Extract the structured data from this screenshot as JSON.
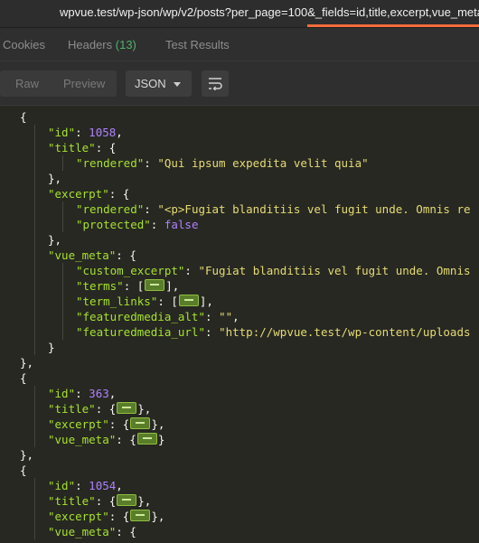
{
  "url_bar": {
    "url": "wpvue.test/wp-json/wp/v2/posts?per_page=100&_fields=id,title,excerpt,vue_meta"
  },
  "tabs": [
    {
      "label": "Cookies"
    },
    {
      "label": "Headers",
      "count": "(13)"
    },
    {
      "label": "Test Results"
    }
  ],
  "toolbar": {
    "raw_label": "Raw",
    "preview_label": "Preview",
    "format_selected": "JSON",
    "wrap_icon": "wrap-lines-icon"
  },
  "colors": {
    "background": "#272822",
    "key": "#a6e22e",
    "number": "#ae81ff",
    "string": "#e6db74",
    "punctuation": "#f8f8f2",
    "accent": "#f26b3a",
    "count": "#4fb26b"
  },
  "json_lines": [
    {
      "indent": 1,
      "parts": [
        {
          "t": "{",
          "c": "p"
        }
      ]
    },
    {
      "indent": 2,
      "parts": [
        {
          "t": "\"id\"",
          "c": "k"
        },
        {
          "t": ": ",
          "c": "p"
        },
        {
          "t": "1058",
          "c": "n"
        },
        {
          "t": ",",
          "c": "p"
        }
      ]
    },
    {
      "indent": 2,
      "parts": [
        {
          "t": "\"title\"",
          "c": "k"
        },
        {
          "t": ": {",
          "c": "p"
        }
      ]
    },
    {
      "indent": 3,
      "parts": [
        {
          "t": "\"rendered\"",
          "c": "k"
        },
        {
          "t": ": ",
          "c": "p"
        },
        {
          "t": "\"Qui ipsum expedita velit quia\"",
          "c": "s"
        }
      ]
    },
    {
      "indent": 2,
      "parts": [
        {
          "t": "},",
          "c": "p"
        }
      ]
    },
    {
      "indent": 2,
      "parts": [
        {
          "t": "\"excerpt\"",
          "c": "k"
        },
        {
          "t": ": {",
          "c": "p"
        }
      ]
    },
    {
      "indent": 3,
      "parts": [
        {
          "t": "\"rendered\"",
          "c": "k"
        },
        {
          "t": ": ",
          "c": "p"
        },
        {
          "t": "\"<p>Fugiat blanditiis vel fugit unde. Omnis re",
          "c": "s"
        }
      ]
    },
    {
      "indent": 3,
      "parts": [
        {
          "t": "\"protected\"",
          "c": "k"
        },
        {
          "t": ": ",
          "c": "p"
        },
        {
          "t": "false",
          "c": "n"
        }
      ]
    },
    {
      "indent": 2,
      "parts": [
        {
          "t": "},",
          "c": "p"
        }
      ]
    },
    {
      "indent": 2,
      "parts": [
        {
          "t": "\"vue_meta\"",
          "c": "k"
        },
        {
          "t": ": {",
          "c": "p"
        }
      ]
    },
    {
      "indent": 3,
      "parts": [
        {
          "t": "\"custom_excerpt\"",
          "c": "k"
        },
        {
          "t": ": ",
          "c": "p"
        },
        {
          "t": "\"Fugiat blanditiis vel fugit unde. Omnis",
          "c": "s"
        }
      ]
    },
    {
      "indent": 3,
      "parts": [
        {
          "t": "\"terms\"",
          "c": "k"
        },
        {
          "t": ": [",
          "c": "p"
        },
        {
          "t": "",
          "c": "badge"
        },
        {
          "t": "],",
          "c": "p"
        }
      ]
    },
    {
      "indent": 3,
      "parts": [
        {
          "t": "\"term_links\"",
          "c": "k"
        },
        {
          "t": ": [",
          "c": "p"
        },
        {
          "t": "",
          "c": "badge"
        },
        {
          "t": "],",
          "c": "p"
        }
      ]
    },
    {
      "indent": 3,
      "parts": [
        {
          "t": "\"featuredmedia_alt\"",
          "c": "k"
        },
        {
          "t": ": ",
          "c": "p"
        },
        {
          "t": "\"\"",
          "c": "s"
        },
        {
          "t": ",",
          "c": "p"
        }
      ]
    },
    {
      "indent": 3,
      "parts": [
        {
          "t": "\"featuredmedia_url\"",
          "c": "k"
        },
        {
          "t": ": ",
          "c": "p"
        },
        {
          "t": "\"http://wpvue.test/wp-content/uploads",
          "c": "s"
        }
      ]
    },
    {
      "indent": 2,
      "parts": [
        {
          "t": "}",
          "c": "p"
        }
      ]
    },
    {
      "indent": 1,
      "parts": [
        {
          "t": "},",
          "c": "p"
        }
      ]
    },
    {
      "indent": 1,
      "parts": [
        {
          "t": "{",
          "c": "p"
        }
      ]
    },
    {
      "indent": 2,
      "parts": [
        {
          "t": "\"id\"",
          "c": "k"
        },
        {
          "t": ": ",
          "c": "p"
        },
        {
          "t": "363",
          "c": "n"
        },
        {
          "t": ",",
          "c": "p"
        }
      ]
    },
    {
      "indent": 2,
      "parts": [
        {
          "t": "\"title\"",
          "c": "k"
        },
        {
          "t": ": {",
          "c": "p"
        },
        {
          "t": "",
          "c": "badge"
        },
        {
          "t": "},",
          "c": "p"
        }
      ]
    },
    {
      "indent": 2,
      "parts": [
        {
          "t": "\"excerpt\"",
          "c": "k"
        },
        {
          "t": ": {",
          "c": "p"
        },
        {
          "t": "",
          "c": "badge"
        },
        {
          "t": "},",
          "c": "p"
        }
      ]
    },
    {
      "indent": 2,
      "parts": [
        {
          "t": "\"vue_meta\"",
          "c": "k"
        },
        {
          "t": ": {",
          "c": "p"
        },
        {
          "t": "",
          "c": "badge"
        },
        {
          "t": "}",
          "c": "p"
        }
      ]
    },
    {
      "indent": 1,
      "parts": [
        {
          "t": "},",
          "c": "p"
        }
      ]
    },
    {
      "indent": 1,
      "parts": [
        {
          "t": "{",
          "c": "p"
        }
      ]
    },
    {
      "indent": 2,
      "parts": [
        {
          "t": "\"id\"",
          "c": "k"
        },
        {
          "t": ": ",
          "c": "p"
        },
        {
          "t": "1054",
          "c": "n"
        },
        {
          "t": ",",
          "c": "p"
        }
      ]
    },
    {
      "indent": 2,
      "parts": [
        {
          "t": "\"title\"",
          "c": "k"
        },
        {
          "t": ": {",
          "c": "p"
        },
        {
          "t": "",
          "c": "badge"
        },
        {
          "t": "},",
          "c": "p"
        }
      ]
    },
    {
      "indent": 2,
      "parts": [
        {
          "t": "\"excerpt\"",
          "c": "k"
        },
        {
          "t": ": {",
          "c": "p"
        },
        {
          "t": "",
          "c": "badge"
        },
        {
          "t": "},",
          "c": "p"
        }
      ]
    },
    {
      "indent": 2,
      "parts": [
        {
          "t": "\"vue_meta\"",
          "c": "k"
        },
        {
          "t": ": {",
          "c": "p"
        }
      ]
    }
  ]
}
